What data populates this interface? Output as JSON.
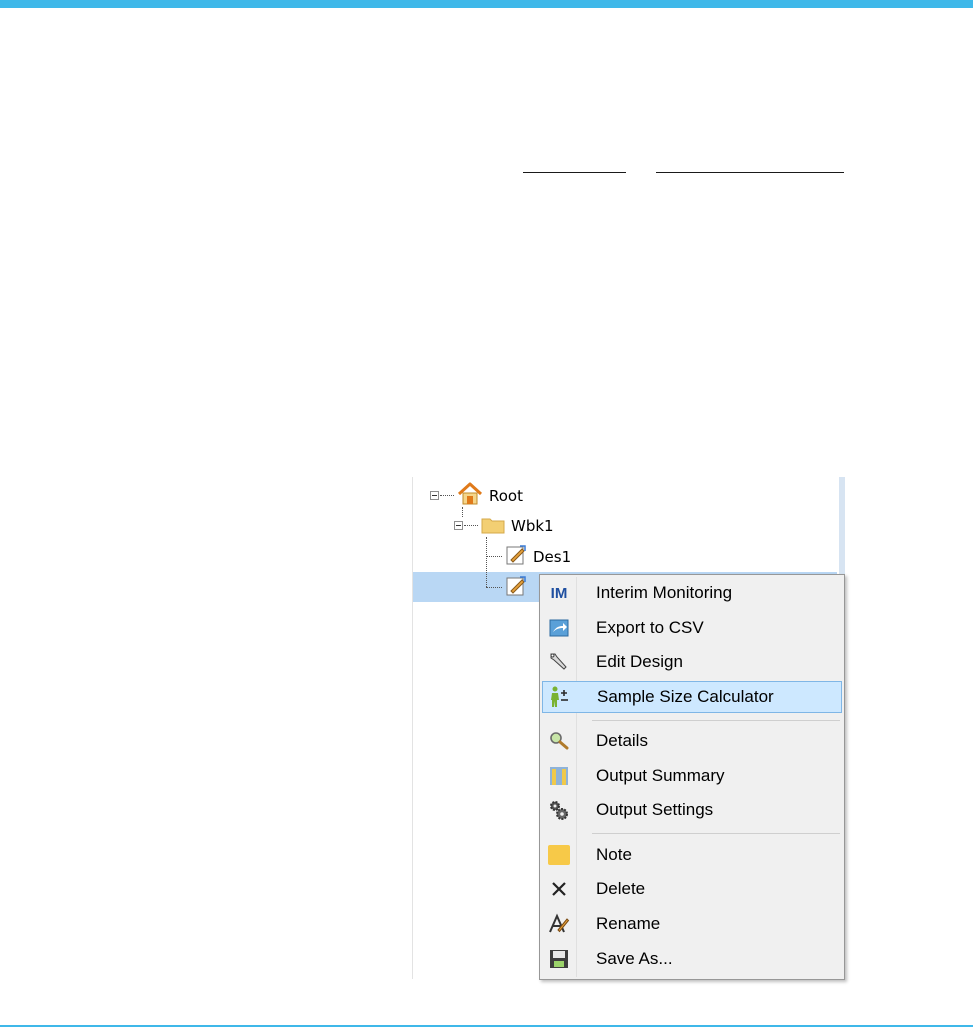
{
  "tree": {
    "items": [
      {
        "label": "Root",
        "icon": "home-icon"
      },
      {
        "label": "Wbk1",
        "icon": "folder-icon"
      },
      {
        "label": "Des1",
        "icon": "design-icon"
      },
      {
        "label": "",
        "icon": "design-icon"
      }
    ]
  },
  "context_menu": {
    "items": [
      {
        "label": "Interim Monitoring",
        "icon": "im-icon",
        "icon_text": "IM"
      },
      {
        "label": "Export to CSV",
        "icon": "export-icon"
      },
      {
        "label": "Edit Design",
        "icon": "wrench-icon"
      },
      {
        "label": "Sample Size Calculator",
        "icon": "calculator-person-icon",
        "highlighted": true
      },
      {
        "label": "Details",
        "icon": "magnifier-icon"
      },
      {
        "label": "Output Summary",
        "icon": "summary-icon"
      },
      {
        "label": "Output Settings",
        "icon": "gears-icon"
      },
      {
        "label": "Note",
        "icon": "note-icon"
      },
      {
        "label": "Delete",
        "icon": "delete-icon"
      },
      {
        "label": "Rename",
        "icon": "rename-icon"
      },
      {
        "label": "Save As...",
        "icon": "save-icon"
      }
    ]
  },
  "colors": {
    "accent": "#3fb8e9",
    "selection": "#b9d7f4",
    "menu_highlight": "#cde8ff",
    "menu_background": "#f0f0f0"
  }
}
